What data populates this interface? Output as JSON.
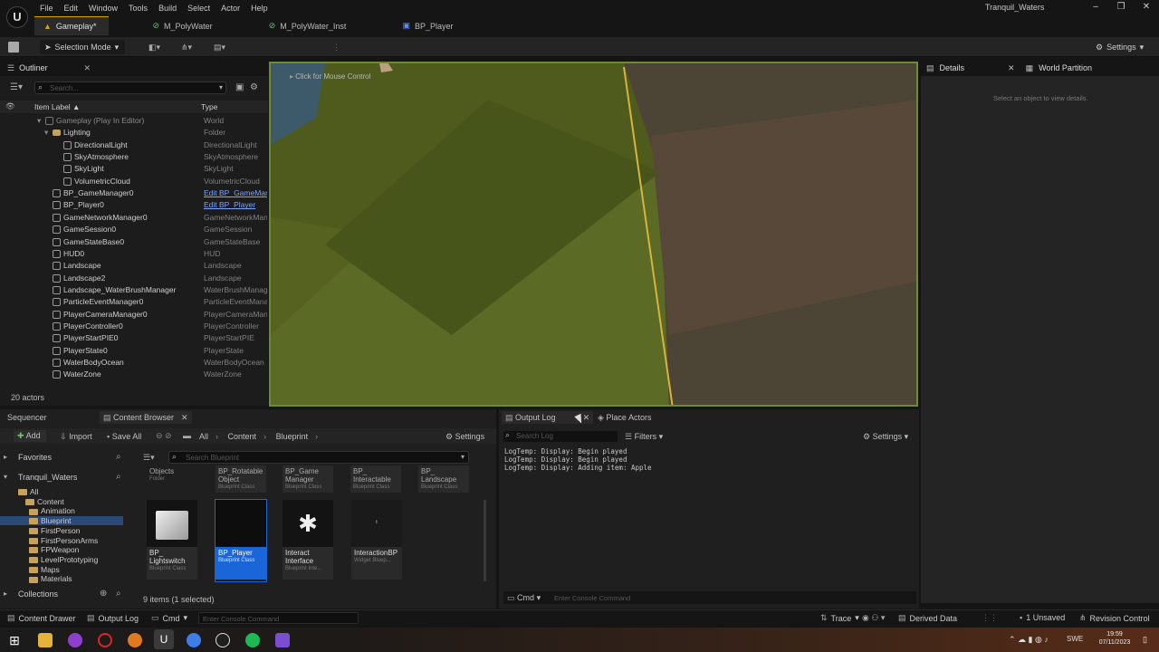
{
  "app": {
    "project_name": "Tranquil_Waters",
    "menu": [
      "File",
      "Edit",
      "Window",
      "Tools",
      "Build",
      "Select",
      "Actor",
      "Help"
    ],
    "tabs": [
      {
        "label": "Gameplay*",
        "active": true
      },
      {
        "label": "M_PolyWater",
        "active": false
      },
      {
        "label": "M_PolyWater_Inst",
        "active": false
      },
      {
        "label": "BP_Player",
        "active": false
      }
    ]
  },
  "toolbar": {
    "selection_mode": "Selection Mode",
    "settings": "Settings"
  },
  "outliner": {
    "title": "Outliner",
    "search_placeholder": "Search...",
    "col_label": "Item Label ▲",
    "col_type": "Type",
    "rows": [
      {
        "label": "Gameplay (Play In Editor)",
        "type": "World",
        "indent": 0,
        "dim": true
      },
      {
        "label": "Lighting",
        "type": "Folder",
        "indent": 1
      },
      {
        "label": "DirectionalLight",
        "type": "DirectionalLight",
        "indent": 2
      },
      {
        "label": "SkyAtmosphere",
        "type": "SkyAtmosphere",
        "indent": 2
      },
      {
        "label": "SkyLight",
        "type": "SkyLight",
        "indent": 2
      },
      {
        "label": "VolumetricCloud",
        "type": "VolumetricCloud",
        "indent": 2
      },
      {
        "label": "BP_GameManager0",
        "type": "Edit BP_GameManager",
        "indent": 1,
        "link": true
      },
      {
        "label": "BP_Player0",
        "type": "Edit BP_Player",
        "indent": 1,
        "link": true
      },
      {
        "label": "GameNetworkManager0",
        "type": "GameNetworkManager",
        "indent": 1
      },
      {
        "label": "GameSession0",
        "type": "GameSession",
        "indent": 1
      },
      {
        "label": "GameStateBase0",
        "type": "GameStateBase",
        "indent": 1
      },
      {
        "label": "HUD0",
        "type": "HUD",
        "indent": 1
      },
      {
        "label": "Landscape",
        "type": "Landscape",
        "indent": 1
      },
      {
        "label": "Landscape2",
        "type": "Landscape",
        "indent": 1
      },
      {
        "label": "Landscape_WaterBrushManager",
        "type": "WaterBrushManager",
        "indent": 1
      },
      {
        "label": "ParticleEventManager0",
        "type": "ParticleEventManager",
        "indent": 1
      },
      {
        "label": "PlayerCameraManager0",
        "type": "PlayerCameraManager",
        "indent": 1
      },
      {
        "label": "PlayerController0",
        "type": "PlayerController",
        "indent": 1
      },
      {
        "label": "PlayerStartPIE0",
        "type": "PlayerStartPIE",
        "indent": 1
      },
      {
        "label": "PlayerState0",
        "type": "PlayerState",
        "indent": 1
      },
      {
        "label": "WaterBodyOcean",
        "type": "WaterBodyOcean",
        "indent": 1
      },
      {
        "label": "WaterZone",
        "type": "WaterZone",
        "indent": 1
      }
    ],
    "actor_count": "20 actors"
  },
  "viewport": {
    "hint": "Click for Mouse Control"
  },
  "details": {
    "title": "Details",
    "world_partition": "World Partition",
    "empty_message": "Select an object to view details."
  },
  "bottom_tabs": {
    "sequencer": "Sequencer",
    "content_browser": "Content Browser",
    "output_log": "Output Log",
    "place_actors": "Place Actors"
  },
  "content_browser": {
    "add": "Add",
    "import": "Import",
    "save_all": "Save All",
    "path": [
      "All",
      "Content",
      "Blueprint"
    ],
    "settings": "Settings",
    "search_placeholder": "Search Blueprint",
    "favorites": "Favorites",
    "project": "Tranquil_Waters",
    "tree": [
      {
        "label": "All",
        "depth": 0
      },
      {
        "label": "Content",
        "depth": 1
      },
      {
        "label": "Animation",
        "depth": 2
      },
      {
        "label": "Blueprint",
        "depth": 2,
        "selected": true
      },
      {
        "label": "FirstPerson",
        "depth": 2
      },
      {
        "label": "FirstPersonArms",
        "depth": 2
      },
      {
        "label": "FPWeapon",
        "depth": 2
      },
      {
        "label": "LevelPrototyping",
        "depth": 2
      },
      {
        "label": "Maps",
        "depth": 2
      },
      {
        "label": "Materials",
        "depth": 2
      }
    ],
    "collections": "Collections",
    "top_row": [
      {
        "label": "Objects",
        "sub": "Folder"
      },
      {
        "label": "BP_Rotatable Object",
        "sub": "Blueprint Class"
      },
      {
        "label": "BP_Game Manager",
        "sub": "Blueprint Class"
      },
      {
        "label": "BP_ Interactable",
        "sub": "Blueprint Class"
      },
      {
        "label": "BP_ Landscape",
        "sub": "Blueprint Class"
      }
    ],
    "assets": [
      {
        "label": "BP_ Lightswitch",
        "sub": "Blueprint Class"
      },
      {
        "label": "BP_Player",
        "sub": "Blueprint Class",
        "selected": true
      },
      {
        "label": "Interact Interface",
        "sub": "Blueprint Inte..."
      },
      {
        "label": "InteractionBP",
        "sub": "Widget Bluep..."
      }
    ],
    "count": "9 items (1 selected)"
  },
  "output_log": {
    "search_placeholder": "Search Log",
    "filters": "Filters",
    "settings": "Settings",
    "lines": [
      "LogTemp: Display: Begin played",
      "LogTemp: Display: Begin played",
      "LogTemp: Display: Adding item: Apple"
    ],
    "cmd": "Cmd",
    "console_placeholder": "Enter Console Command"
  },
  "statusbar": {
    "content_drawer": "Content Drawer",
    "output_log": "Output Log",
    "cmd": "Cmd",
    "console_placeholder": "Enter Console Command",
    "trace": "Trace",
    "derived_data": "Derived Data",
    "unsaved": "1 Unsaved",
    "revision_control": "Revision Control"
  },
  "taskbar": {
    "lang": "SWE",
    "time": "19:59",
    "date": "07/11/2023"
  }
}
